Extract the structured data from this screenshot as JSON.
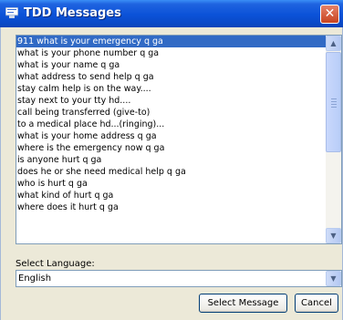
{
  "window": {
    "title": "TDD Messages",
    "close_label": "✕"
  },
  "messages": {
    "items": [
      "911 what is your emergency q ga",
      "what is your phone number q ga",
      "what is your name q ga",
      "what address to send help q ga",
      "stay calm help is on the way....",
      "stay next to your tty hd....",
      "call being transferred (give-to)",
      "to a medical place hd...(ringing)...",
      "what is your home address q ga",
      "where is the emergency now q ga",
      "is anyone hurt q ga",
      "does he or she need medical help q ga",
      "who is hurt q ga",
      "what kind of hurt q ga",
      "where does it hurt q ga"
    ],
    "selected_index": 0
  },
  "language": {
    "label": "Select Language:",
    "value": "English"
  },
  "buttons": {
    "select": "Select Message",
    "cancel": "Cancel"
  },
  "colors": {
    "titlebar": "#0b52d8",
    "selection": "#316ac5",
    "background": "#ece9d8"
  }
}
